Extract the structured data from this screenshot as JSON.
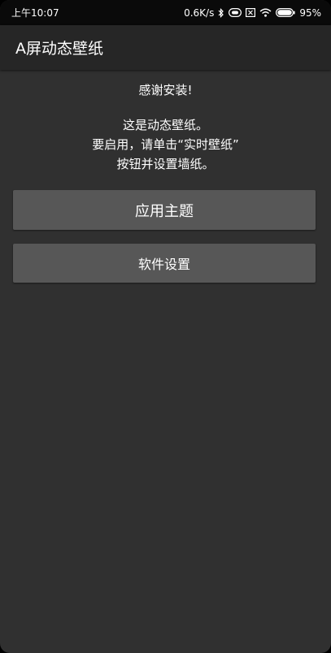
{
  "status_bar": {
    "time": "上午10:07",
    "net_speed": "0.6K/s",
    "battery": "95%",
    "icons": [
      "bluetooth-icon",
      "sim-icon",
      "sim-disabled-icon",
      "wifi-icon",
      "battery-icon"
    ]
  },
  "app_bar": {
    "title": "A屏动态壁纸"
  },
  "main": {
    "thanks": "感谢安装!",
    "desc_lines": [
      "这是动态壁纸。",
      "要启用，请单击“实时壁纸”",
      "按钮并设置墙纸。"
    ],
    "buttons": {
      "apply_theme": "应用主题",
      "settings": "软件设置"
    }
  },
  "colors": {
    "background": "#303030",
    "app_bar": "#262626",
    "status_bar": "#0a0a0a",
    "button": "#575757",
    "text": "#ffffff"
  }
}
